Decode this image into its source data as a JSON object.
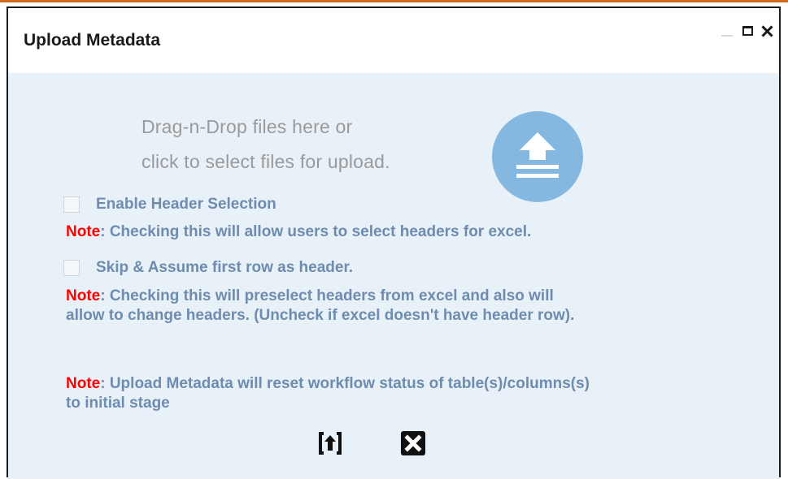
{
  "dialog": {
    "title": "Upload Metadata",
    "window_controls": [
      "minimize-icon",
      "maximize-icon",
      "close-icon"
    ]
  },
  "dropzone": {
    "line1": "Drag-n-Drop files here or",
    "line2": "click to select files for upload.",
    "icon": "upload-icon"
  },
  "options": {
    "enable_header": {
      "label": "Enable Header Selection",
      "checked": false,
      "note_key": "Note",
      "note_text": ": Checking this will allow users to select headers for excel."
    },
    "skip_header": {
      "label": "Skip & Assume first row as header.",
      "checked": false,
      "note_key": "Note",
      "note_line1": ": Checking this will preselect headers from excel and also will",
      "note_line2": "allow to change headers. (Uncheck if excel doesn't have header row)."
    }
  },
  "workflow_note": {
    "note_key": "Note",
    "line1": ": Upload Metadata will reset workflow status of table(s)/columns(s)",
    "line2": "to initial stage"
  },
  "actions": [
    "upload-icon",
    "cancel-icon"
  ],
  "colors": {
    "accent_rule": "#d2691e",
    "body_bg": "#e8f1f8",
    "label_text": "#6e8caf",
    "note_key": "#ff0000",
    "upload_circle": "#85b8e0"
  }
}
